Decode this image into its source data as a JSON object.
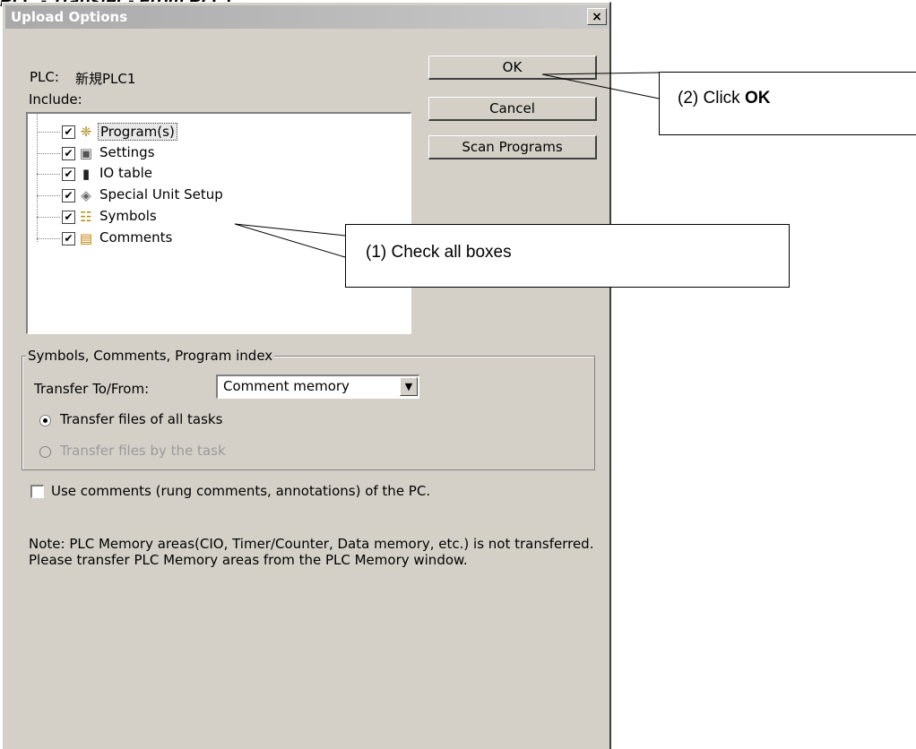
{
  "caption": "PLC - Transfer - From PLC)",
  "dialog": {
    "title": "Upload Options",
    "close_glyph": "×",
    "plc_label": "PLC:",
    "plc_name": "新規PLC1",
    "include_label": "Include:",
    "buttons": {
      "ok": "OK",
      "cancel": "Cancel",
      "scan": "Scan Programs"
    },
    "tree_items": [
      {
        "label": "Program(s)",
        "checked": true,
        "icon": "program-icon"
      },
      {
        "label": "Settings",
        "checked": true,
        "icon": "settings-icon"
      },
      {
        "label": "IO table",
        "checked": true,
        "icon": "io-table-icon"
      },
      {
        "label": "Special Unit Setup",
        "checked": true,
        "icon": "special-unit-icon"
      },
      {
        "label": "Symbols",
        "checked": true,
        "icon": "symbols-icon"
      },
      {
        "label": "Comments",
        "checked": true,
        "icon": "comments-icon"
      }
    ],
    "group_title": "Symbols, Comments, Program index",
    "transfer_label": "Transfer To/From:",
    "transfer_value": "Comment memory",
    "radio_all": "Transfer files of all tasks",
    "radio_task": "Transfer files by the task",
    "use_comments": "Use comments (rung comments, annotations) of the PC.",
    "note": "Note: PLC Memory areas(CIO, Timer/Counter, Data memory, etc.) is not transferred. Please transfer PLC Memory areas from the PLC Memory window."
  },
  "callouts": {
    "ok_prefix": "(2) Click ",
    "ok_bold": "OK",
    "check": "(1)  Check all boxes"
  }
}
